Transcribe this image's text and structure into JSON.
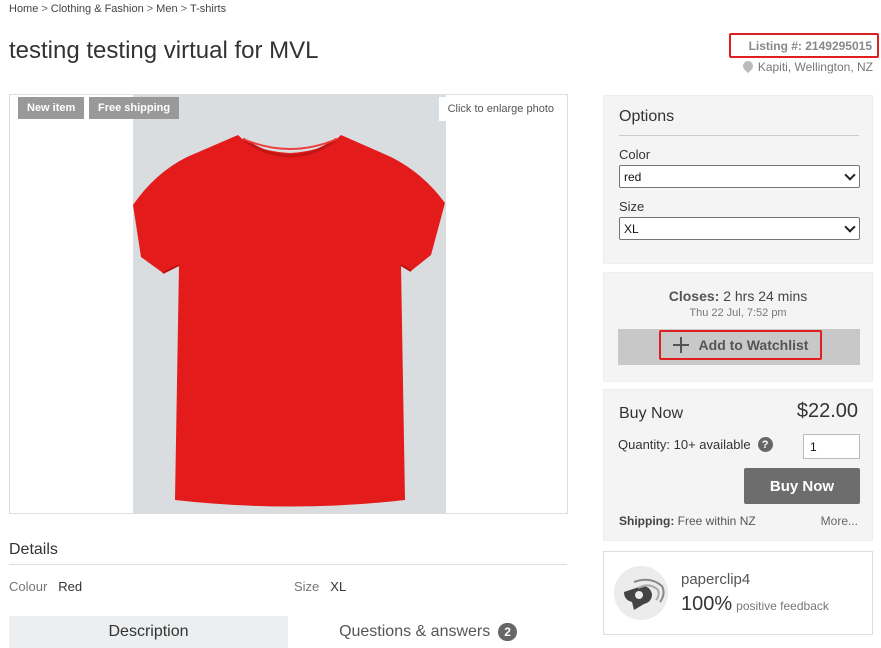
{
  "breadcrumb": {
    "items": [
      "Home",
      "Clothing & Fashion",
      "Men",
      "T-shirts"
    ],
    "separator": ">"
  },
  "listing": {
    "title": "testing testing virtual for MVL",
    "number_label": "Listing #: 2149295015",
    "location": "Kapiti, Wellington, NZ"
  },
  "photo": {
    "badges": [
      "New item",
      "Free shipping"
    ],
    "enlarge_label": "Click to enlarge photo",
    "shirt_color": "#e31b1b"
  },
  "details": {
    "heading": "Details",
    "colour_label": "Colour",
    "colour_value": "Red",
    "size_label": "Size",
    "size_value": "XL"
  },
  "tabs": {
    "description": "Description",
    "qa": "Questions & answers",
    "qa_count": "2"
  },
  "options": {
    "heading": "Options",
    "color_label": "Color",
    "color_value": "red",
    "size_label": "Size",
    "size_value": "XL"
  },
  "closing": {
    "label": "Closes:",
    "value": "2 hrs 24 mins",
    "date": "Thu 22 Jul, 7:52 pm",
    "watchlist_label": "Add to Watchlist"
  },
  "buy": {
    "title": "Buy Now",
    "price": "$22.00",
    "quantity_label": "Quantity: 10+ available",
    "help": "?",
    "quantity_value": "1",
    "button": "Buy Now",
    "shipping_label": "Shipping:",
    "shipping_value": "Free within NZ",
    "more": "More..."
  },
  "seller": {
    "name": "paperclip4",
    "feedback_pct": "100%",
    "feedback_label": "positive feedback"
  },
  "colors": {
    "highlight": "#e02020",
    "panel_bg": "#f4f4f4",
    "button_dark": "#6d6d6d"
  }
}
